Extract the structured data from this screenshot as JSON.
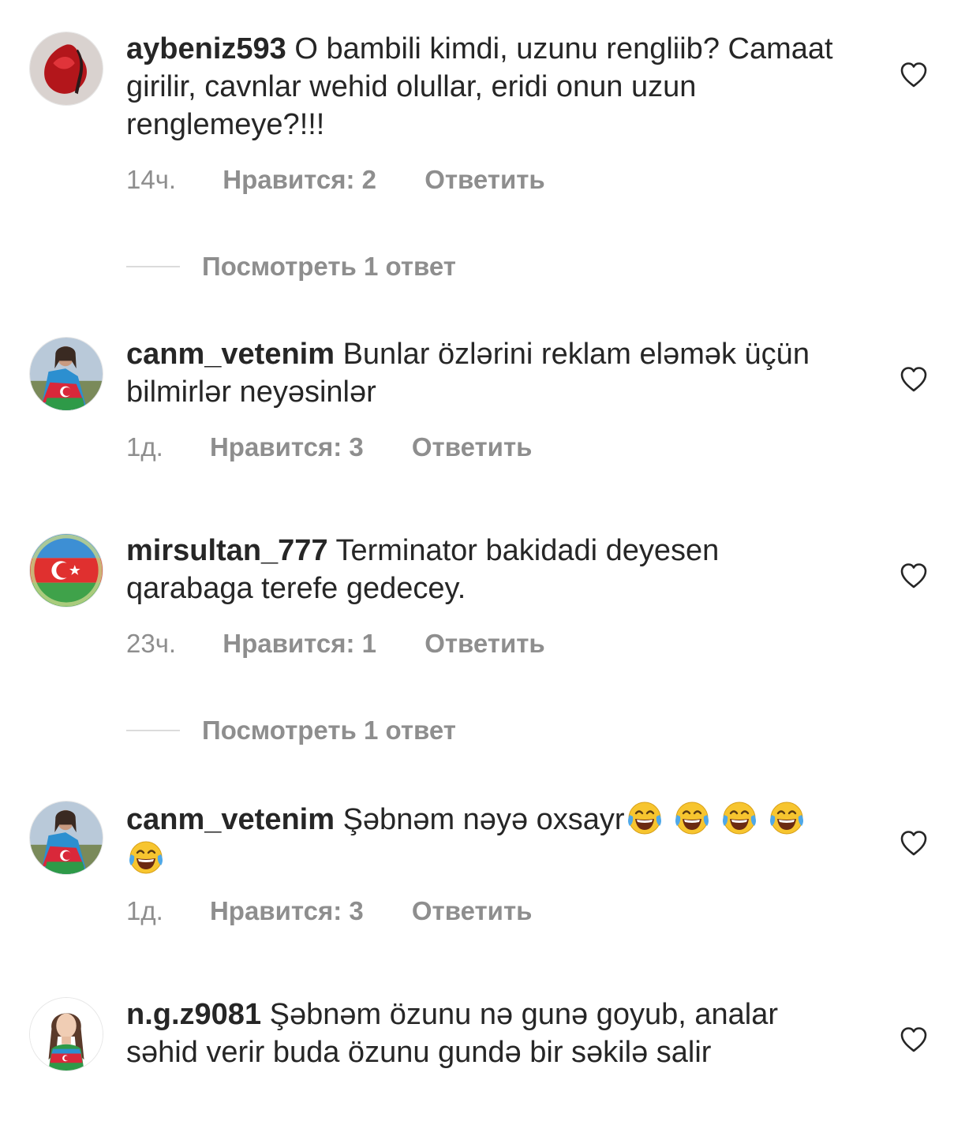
{
  "comments": [
    {
      "username": "aybeniz593",
      "text": "O bambili kimdi, uzunu rengliib? Camaat girilir, cavnlar wehid olullar, eridi onun uzun renglemeye?!!!",
      "time": "14ч.",
      "likes": "Нравится: 2",
      "reply": "Ответить",
      "avatar": "red-dress-photo"
    },
    {
      "username": "canm_vetenim",
      "text": "Bunlar özlərini reklam eləmək üçün bilmirlər neyəsinlər",
      "time": "1д.",
      "likes": "Нравится: 3",
      "reply": "Ответить",
      "avatar": "woman-with-flag-photo"
    },
    {
      "username": "mirsultan_777",
      "text": "Terminator bakidadi deyesen qarabaga terefe gedecey.",
      "time": "23ч.",
      "likes": "Нравится: 1",
      "reply": "Ответить",
      "avatar": "azerbaijan-map-flag"
    },
    {
      "username": "canm_vetenim",
      "text": "Şəbnəm nəyə oxsayr",
      "emojis": [
        "face-with-tears-of-joy",
        "face-with-tears-of-joy",
        "face-with-tears-of-joy",
        "face-with-tears-of-joy",
        "face-with-tears-of-joy"
      ],
      "time": "1д.",
      "likes": "Нравится: 3",
      "reply": "Ответить",
      "avatar": "woman-with-flag-photo"
    },
    {
      "username": "n.g.z9081",
      "text": "Şəbnəm özunu nə gunə goyub, analar səhid verir buda özunu gundə bir səkilə salir",
      "avatar": "illustrated-woman-flag"
    }
  ],
  "view_replies": [
    {
      "label": "Посмотреть 1 ответ"
    },
    {
      "label": "Посмотреть 1 ответ"
    }
  ],
  "icons": {
    "like": "heart-outline-icon",
    "emoji": "face-with-tears-of-joy"
  },
  "colors": {
    "primary_text": "#262626",
    "secondary_text": "#8e8e8e",
    "divider": "#dbdbdb"
  }
}
